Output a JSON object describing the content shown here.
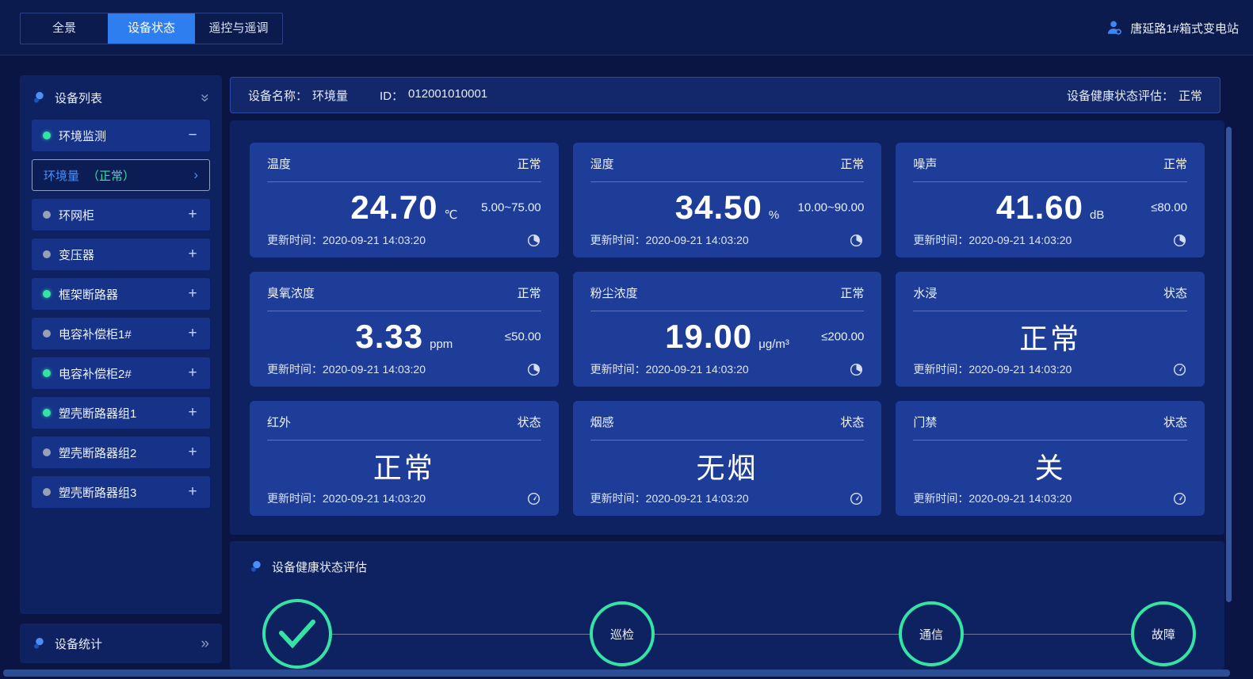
{
  "colors": {
    "accent_blue": "#2e7ef0",
    "status_green": "#35e3a5",
    "dot_gray": "#97a0b4",
    "card_blue": "#1e3d99"
  },
  "topbar": {
    "tabs": [
      {
        "label": "全景",
        "active": false
      },
      {
        "label": "设备状态",
        "active": true
      },
      {
        "label": "遥控与遥调",
        "active": false
      }
    ],
    "station_name": "唐延路1#箱式变电站"
  },
  "sidebar": {
    "list_title": "设备列表",
    "collapse_glyph": "»",
    "items": [
      {
        "label": "环境监测",
        "dot": "green",
        "toggle": "−"
      },
      {
        "label": "环网柜",
        "dot": "gray",
        "toggle": "+"
      },
      {
        "label": "变压器",
        "dot": "gray",
        "toggle": "+"
      },
      {
        "label": "框架断路器",
        "dot": "green",
        "toggle": "+"
      },
      {
        "label": "电容补偿柜1#",
        "dot": "gray",
        "toggle": "+"
      },
      {
        "label": "电容补偿柜2#",
        "dot": "green",
        "toggle": "+"
      },
      {
        "label": "塑壳断路器组1",
        "dot": "green",
        "toggle": "+"
      },
      {
        "label": "塑壳断路器组2",
        "dot": "gray",
        "toggle": "+"
      },
      {
        "label": "塑壳断路器组3",
        "dot": "gray",
        "toggle": "+"
      }
    ],
    "active_sub_item": {
      "name": "环境量",
      "status": "（正常）",
      "chevron": "›"
    },
    "stats_title": "设备统计",
    "stats_glyph": "»"
  },
  "main": {
    "header": {
      "name_label": "设备名称：",
      "name": "环境量",
      "id_label": "ID：",
      "id": "012001010001",
      "health_label": "设备健康状态评估：",
      "health_value": "正常"
    },
    "updated_label": "更新时间：",
    "cards": [
      {
        "title": "温度",
        "badge": "正常",
        "value": "24.70",
        "unit": "℃",
        "range": "5.00~75.00",
        "updated": "2020-09-21 14:03:20",
        "icon": "clock"
      },
      {
        "title": "湿度",
        "badge": "正常",
        "value": "34.50",
        "unit": "%",
        "range": "10.00~90.00",
        "updated": "2020-09-21 14:03:20",
        "icon": "clock"
      },
      {
        "title": "噪声",
        "badge": "正常",
        "value": "41.60",
        "unit": "dB",
        "range": "≤80.00",
        "updated": "2020-09-21 14:03:20",
        "icon": "clock"
      },
      {
        "title": "臭氧浓度",
        "badge": "正常",
        "value": "3.33",
        "unit": "ppm",
        "range": "≤50.00",
        "updated": "2020-09-21 14:03:20",
        "icon": "clock"
      },
      {
        "title": "粉尘浓度",
        "badge": "正常",
        "value": "19.00",
        "unit": "μg/m³",
        "range": "≤200.00",
        "updated": "2020-09-21 14:03:20",
        "icon": "clock"
      },
      {
        "title": "水浸",
        "badge": "状态",
        "state": "正常",
        "updated": "2020-09-21 14:03:20",
        "icon": "gauge"
      },
      {
        "title": "红外",
        "badge": "状态",
        "state": "正常",
        "updated": "2020-09-21 14:03:20",
        "icon": "gauge"
      },
      {
        "title": "烟感",
        "badge": "状态",
        "state": "无烟",
        "updated": "2020-09-21 14:03:20",
        "icon": "gauge"
      },
      {
        "title": "门禁",
        "badge": "状态",
        "state": "关",
        "updated": "2020-09-21 14:03:20",
        "icon": "gauge"
      }
    ],
    "health": {
      "title": "设备健康状态评估",
      "nodes": [
        {
          "type": "check",
          "label": ""
        },
        {
          "type": "label",
          "label": "巡检"
        },
        {
          "type": "label",
          "label": "通信"
        },
        {
          "type": "label",
          "label": "故障"
        }
      ]
    }
  }
}
